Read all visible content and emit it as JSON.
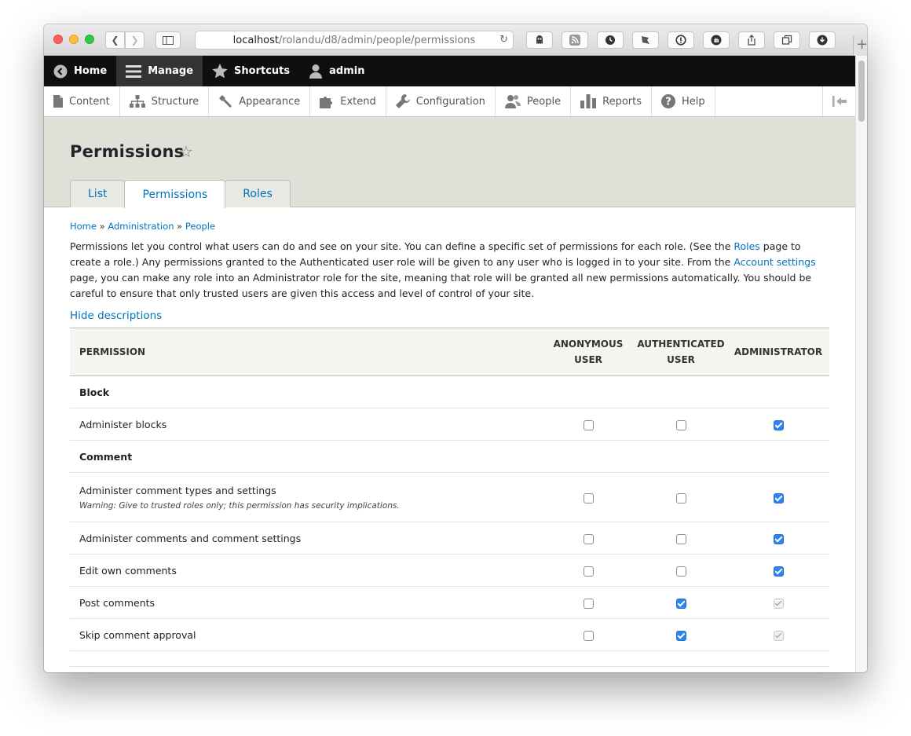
{
  "browser": {
    "url_host": "localhost",
    "url_path": "/rolandu/d8/admin/people/permissions"
  },
  "toolbar": {
    "home": "Home",
    "manage": "Manage",
    "shortcuts": "Shortcuts",
    "user": "admin"
  },
  "tray": {
    "items": [
      "Content",
      "Structure",
      "Appearance",
      "Extend",
      "Configuration",
      "People",
      "Reports",
      "Help"
    ]
  },
  "page": {
    "title": "Permissions",
    "tabs": [
      "List",
      "Permissions",
      "Roles"
    ]
  },
  "breadcrumb": {
    "home": "Home",
    "sep1": " » ",
    "administration": "Administration",
    "sep2": " » ",
    "people": "People"
  },
  "intro": {
    "part1": "Permissions let you control what users can do and see on your site. You can define a specific set of permissions for each role. (See the ",
    "roles_link": "Roles",
    "part2": " page to create a role.) Any permissions granted to the Authenticated user role will be given to any user who is logged in to your site. From the ",
    "account_link": "Account settings",
    "part3": " page, you can make any role into an Administrator role for the site, meaning that role will be granted all new permissions automatically. You should be careful to ensure that only trusted users are given this access and level of control of your site."
  },
  "hide_descriptions": "Hide descriptions",
  "table": {
    "col_permission": "Permission",
    "col_anon_line1": "Anonymous",
    "col_anon_line2": "user",
    "col_auth_line1": "Authenticated",
    "col_auth_line2": "user",
    "col_admin": "Administrator",
    "module_block": "Block",
    "module_comment": "Comment",
    "rows": [
      {
        "label": "Administer blocks",
        "warning": "",
        "anon": "off",
        "auth": "off",
        "admin": "on"
      },
      {
        "label": "Administer comment types and settings",
        "warning": "Warning: Give to trusted roles only; this permission has security implications.",
        "anon": "off",
        "auth": "off",
        "admin": "on"
      },
      {
        "label": "Administer comments and comment settings",
        "warning": "",
        "anon": "off",
        "auth": "off",
        "admin": "on"
      },
      {
        "label": "Edit own comments",
        "warning": "",
        "anon": "off",
        "auth": "off",
        "admin": "on"
      },
      {
        "label": "Post comments",
        "warning": "",
        "anon": "off",
        "auth": "on",
        "admin": "disabled"
      },
      {
        "label": "Skip comment approval",
        "warning": "",
        "anon": "off",
        "auth": "on",
        "admin": "disabled"
      }
    ]
  },
  "colors": {
    "link": "#0074bd",
    "toolbar_bg": "#0f0f0f",
    "header_bg": "#e0e0d8",
    "checkbox_on": "#2f83ee"
  }
}
